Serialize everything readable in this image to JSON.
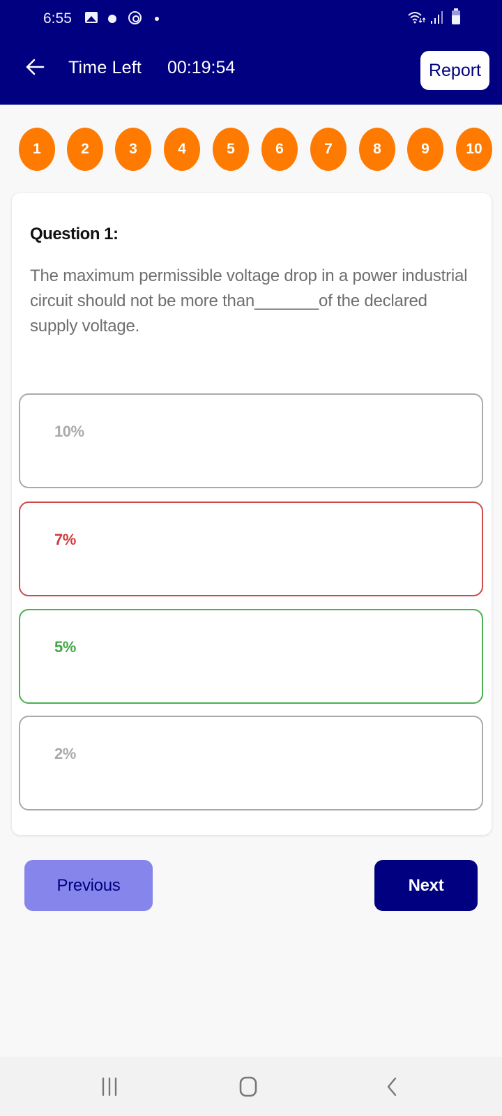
{
  "status_bar": {
    "time": "6:55",
    "icons": [
      "gallery-icon",
      "messenger-icon",
      "sync-icon",
      "notification-dot-icon",
      "wifi-icon",
      "signal-icon",
      "battery-icon"
    ]
  },
  "header": {
    "back_icon": "arrow-left-icon",
    "title_label": "Time Left",
    "timer_value": "00:19:54",
    "report_label": "Report",
    "background_color": "#010080"
  },
  "question_nav": {
    "items": [
      "1",
      "2",
      "3",
      "4",
      "5",
      "6",
      "7",
      "8",
      "9",
      "10"
    ],
    "color": "#ff7a00"
  },
  "question": {
    "title": "Question 1:",
    "text": "The maximum permissible voltage drop in a power industrial circuit should not be more than_______of the declared supply voltage.",
    "options": [
      {
        "label": "10%",
        "state": "neutral"
      },
      {
        "label": "7%",
        "state": "wrong"
      },
      {
        "label": "5%",
        "state": "correct"
      },
      {
        "label": "2%",
        "state": "neutral"
      }
    ],
    "colors": {
      "neutral": "#aaaaaa",
      "wrong": "#d03a3a",
      "correct": "#3fa845"
    }
  },
  "footer": {
    "previous_label": "Previous",
    "next_label": "Next"
  },
  "system_nav": {
    "recents_icon": "recents-icon",
    "home_icon": "home-icon",
    "back_icon": "back-chevron-icon"
  }
}
